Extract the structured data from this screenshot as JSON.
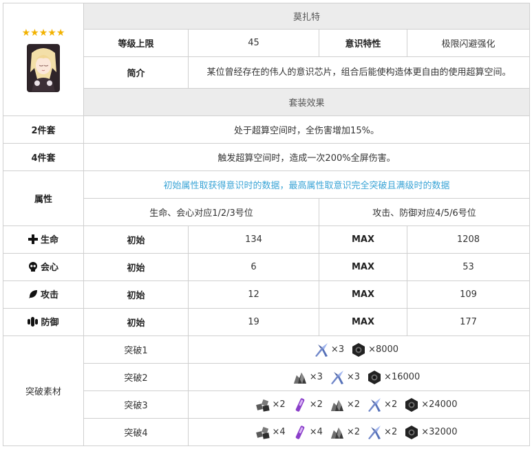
{
  "rarity_stars": "★★★★★",
  "name": "莫扎特",
  "level_cap_label": "等级上限",
  "level_cap_value": "45",
  "trait_label": "意识特性",
  "trait_value": "极限闪避强化",
  "intro_label": "简介",
  "intro_text": "某位曾经存在的伟人的意识芯片，组合后能使构造体更自由的使用超算空间。",
  "set_effect_header": "套装效果",
  "set2_label": "2件套",
  "set2_text": "处于超算空间时，全伤害增加15%。",
  "set4_label": "4件套",
  "set4_text": "触发超算空间时，造成一次200%全屏伤害。",
  "attr_label": "属性",
  "attr_note": "初始属性取获得意识时的数据，最高属性取意识完全突破且满级时的数据",
  "slots_a": "生命、会心对应1/2/3号位",
  "slots_b": "攻击、防御对应4/5/6号位",
  "stats": [
    {
      "name": "生命",
      "icon": "plus-icon",
      "init_label": "初始",
      "init": "134",
      "max_label": "MAX",
      "max": "1208"
    },
    {
      "name": "会心",
      "icon": "skull-icon",
      "init_label": "初始",
      "init": "6",
      "max_label": "MAX",
      "max": "53"
    },
    {
      "name": "攻击",
      "icon": "feather-icon",
      "init_label": "初始",
      "init": "12",
      "max_label": "MAX",
      "max": "109"
    },
    {
      "name": "防御",
      "icon": "shield-icon",
      "init_label": "初始",
      "init": "19",
      "max_label": "MAX",
      "max": "177"
    }
  ],
  "breakthrough_label": "突破素材",
  "breakthroughs": [
    {
      "label": "突破1",
      "materials": [
        {
          "icon": "crystal-shard-icon",
          "qty": "×3"
        },
        {
          "icon": "hex-nut-icon",
          "qty": "×8000"
        }
      ]
    },
    {
      "label": "突破2",
      "materials": [
        {
          "icon": "ore-chunk-icon",
          "qty": "×3"
        },
        {
          "icon": "crystal-shard-icon",
          "qty": "×3"
        },
        {
          "icon": "hex-nut-icon",
          "qty": "×16000"
        }
      ]
    },
    {
      "label": "突破3",
      "materials": [
        {
          "icon": "cube-cluster-icon",
          "qty": "×2"
        },
        {
          "icon": "purple-tube-icon",
          "qty": "×2"
        },
        {
          "icon": "ore-chunk-icon",
          "qty": "×2"
        },
        {
          "icon": "crystal-shard-icon",
          "qty": "×2"
        },
        {
          "icon": "hex-nut-icon",
          "qty": "×24000"
        }
      ]
    },
    {
      "label": "突破4",
      "materials": [
        {
          "icon": "cube-cluster-icon",
          "qty": "×4"
        },
        {
          "icon": "purple-tube-icon",
          "qty": "×4"
        },
        {
          "icon": "ore-chunk-icon",
          "qty": "×2"
        },
        {
          "icon": "crystal-shard-icon",
          "qty": "×2"
        },
        {
          "icon": "hex-nut-icon",
          "qty": "×32000"
        }
      ]
    }
  ],
  "colors": {
    "header_bg": "#ececec",
    "border": "#cfcfcf",
    "note_blue": "#3aa4d6",
    "star": "#f2b200"
  }
}
